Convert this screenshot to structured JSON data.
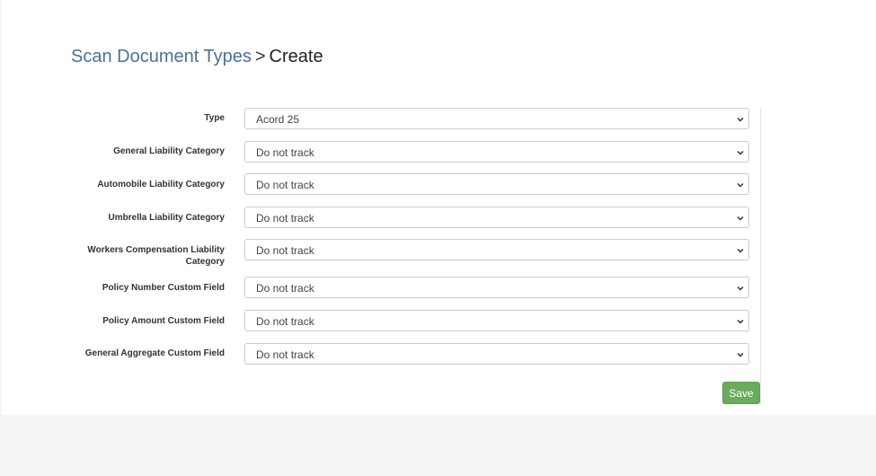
{
  "breadcrumb": {
    "parent": "Scan Document Types",
    "separator": ">",
    "current": "Create"
  },
  "form": {
    "fields": [
      {
        "label": "Type",
        "value": "Acord 25"
      },
      {
        "label": "General Liability Category",
        "value": "Do not track"
      },
      {
        "label": "Automobile Liability Category",
        "value": "Do not track"
      },
      {
        "label": "Umbrella Liability Category",
        "value": "Do not track"
      },
      {
        "label": "Workers Compensation Liability Category",
        "value": "Do not track"
      },
      {
        "label": "Policy Number Custom Field",
        "value": "Do not track"
      },
      {
        "label": "Policy Amount Custom Field",
        "value": "Do not track"
      },
      {
        "label": "General Aggregate Custom Field",
        "value": "Do not track"
      }
    ],
    "save_label": "Save"
  },
  "colors": {
    "link": "#4a6fa0",
    "save_button": "#6aac5c",
    "page_background": "#f5f5f5"
  }
}
